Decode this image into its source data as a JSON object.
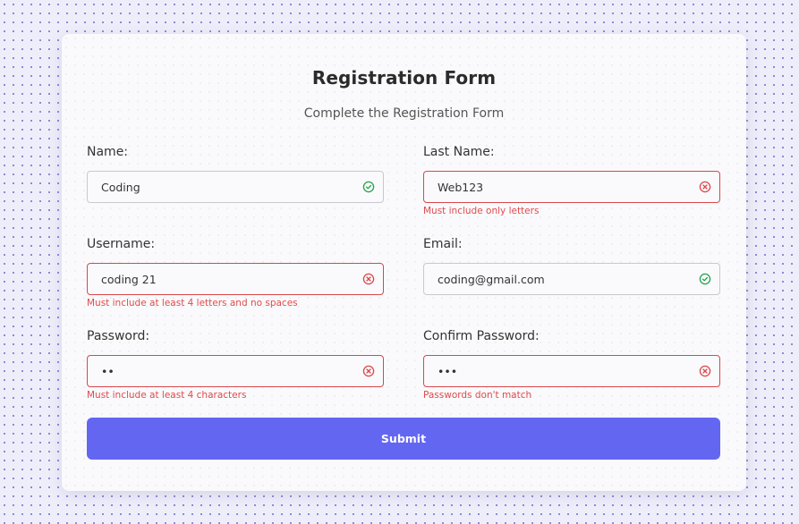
{
  "form": {
    "title": "Registration Form",
    "subtitle": "Complete the Registration Form",
    "submit_label": "Submit",
    "fields": {
      "name": {
        "label": "Name:",
        "value": "Coding",
        "status": "valid",
        "error": ""
      },
      "last_name": {
        "label": "Last Name:",
        "value": "Web123",
        "status": "invalid",
        "error": "Must include only letters"
      },
      "username": {
        "label": "Username:",
        "value": "coding 21",
        "status": "invalid",
        "error": "Must include at least 4 letters and no spaces"
      },
      "email": {
        "label": "Email:",
        "value": "coding@gmail.com",
        "status": "valid",
        "error": ""
      },
      "password": {
        "label": "Password:",
        "value": "12",
        "status": "invalid",
        "error": "Must include at least 4 characters"
      },
      "confirm_password": {
        "label": "Confirm Password:",
        "value": "123",
        "status": "invalid",
        "error": "Passwords don't match"
      }
    }
  },
  "colors": {
    "accent": "#6366f1",
    "valid": "#22a34a",
    "invalid": "#d9484a",
    "error_text": "#e04b4b"
  },
  "icons": {
    "valid": "check-circle-icon",
    "invalid": "x-circle-icon"
  }
}
